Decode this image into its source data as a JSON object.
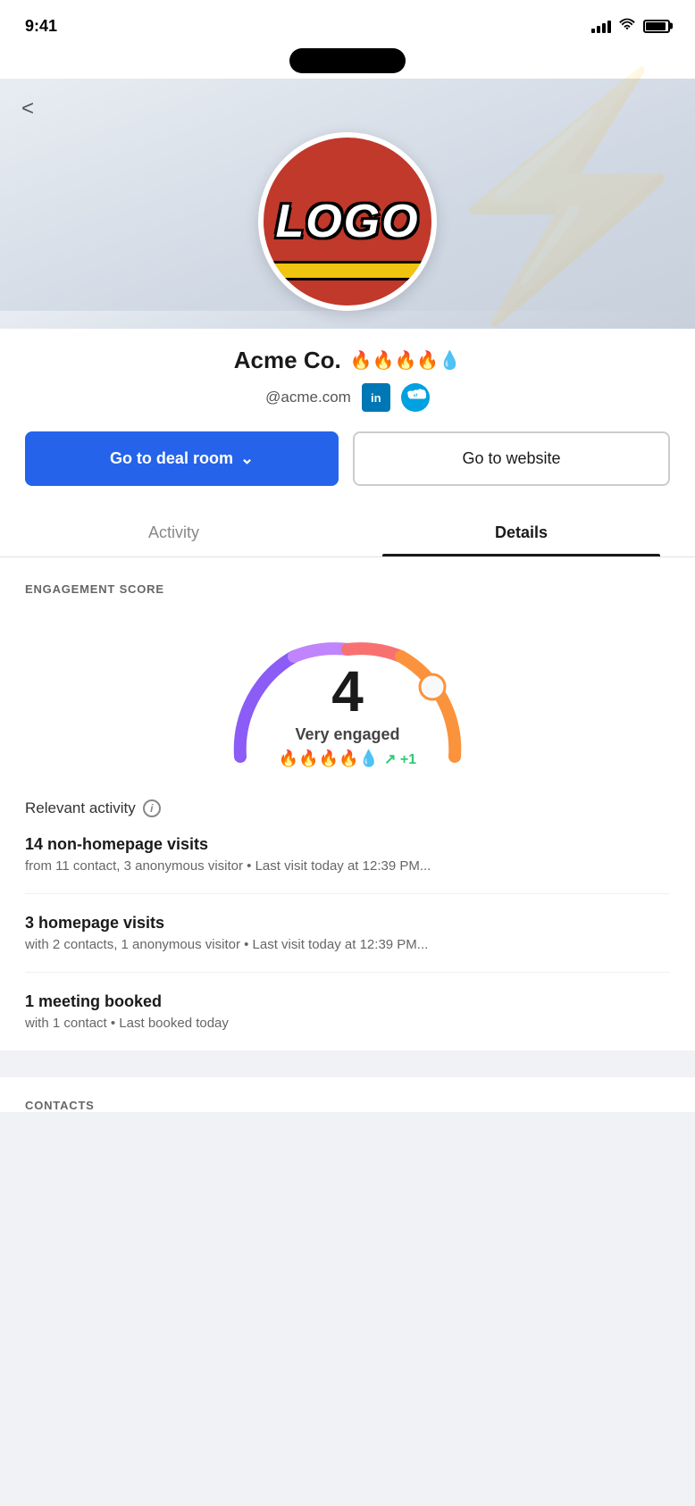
{
  "statusBar": {
    "time": "9:41",
    "icons": [
      "signal",
      "wifi",
      "battery"
    ]
  },
  "back": {
    "icon": "<",
    "label": "Back"
  },
  "company": {
    "logo_text": "LOGO",
    "name": "Acme Co.",
    "fires": "🔥🔥🔥🔥💧",
    "handle": "@acme.com",
    "linkedin_label": "in",
    "salesforce_label": "sf"
  },
  "buttons": {
    "deal_room": "Go to deal room",
    "website": "Go to website",
    "dropdown_icon": "⌄"
  },
  "tabs": [
    {
      "label": "Activity",
      "active": false
    },
    {
      "label": "Details",
      "active": true
    }
  ],
  "engagementScore": {
    "section_title": "ENGAGEMENT SCORE",
    "score": "4",
    "label": "Very engaged",
    "fires": "🔥🔥🔥🔥💧",
    "delta": "↗ +1"
  },
  "relevantActivity": {
    "label": "Relevant activity",
    "items": [
      {
        "title": "14 non-homepage visits",
        "desc": "from 11 contact, 3 anonymous visitor • Last visit today at 12:39 PM..."
      },
      {
        "title": "3 homepage visits",
        "desc": "with 2 contacts, 1 anonymous visitor • Last visit today at 12:39 PM..."
      },
      {
        "title": "1 meeting booked",
        "desc": "with 1 contact • Last booked today"
      }
    ]
  },
  "contacts": {
    "section_title": "CONTACTS"
  }
}
